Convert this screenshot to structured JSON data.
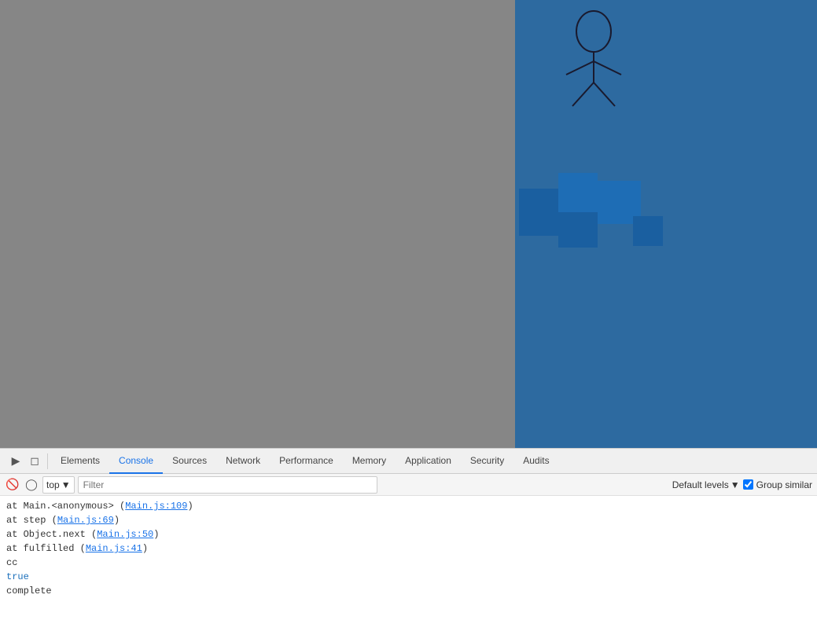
{
  "canvas": {
    "left_bg": "#868686",
    "right_bg": "#2d6aa0"
  },
  "devtools": {
    "tabs": [
      {
        "label": "Elements",
        "active": false
      },
      {
        "label": "Console",
        "active": true
      },
      {
        "label": "Sources",
        "active": false
      },
      {
        "label": "Network",
        "active": false
      },
      {
        "label": "Performance",
        "active": false
      },
      {
        "label": "Memory",
        "active": false
      },
      {
        "label": "Application",
        "active": false
      },
      {
        "label": "Security",
        "active": false
      },
      {
        "label": "Audits",
        "active": false
      }
    ],
    "toolbar": {
      "context": "top",
      "filter_placeholder": "Filter",
      "default_levels_label": "Default levels",
      "group_similar_label": "Group similar",
      "group_similar_checked": true
    },
    "console_lines": [
      {
        "text": "at Main.<anonymous> (Main.js:109)",
        "has_link": true,
        "link_text": "Main.js:109",
        "prefix": "at Main.<anonymous> (",
        "suffix": ")"
      },
      {
        "text": "at step (Main.js:69)",
        "has_link": true,
        "link_text": "Main.js:69",
        "prefix": "at step (",
        "suffix": ")"
      },
      {
        "text": "at Object.next (Main.js:50)",
        "has_link": true,
        "link_text": "Main.js:50",
        "prefix": "at Object.next (",
        "suffix": ")"
      },
      {
        "text": "at fulfilled (Main.js:41)",
        "has_link": true,
        "link_text": "Main.js:41",
        "prefix": "at fulfilled (",
        "suffix": ")"
      }
    ],
    "cc_label": "cc",
    "true_label": "true",
    "complete_label": "complete"
  }
}
